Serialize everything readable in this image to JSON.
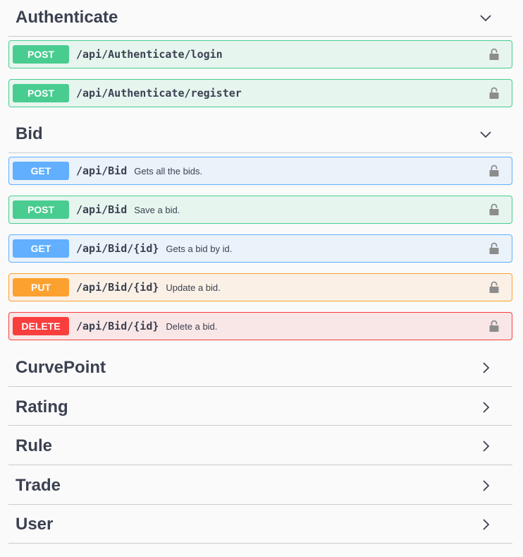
{
  "sections": {
    "authenticate": {
      "title": "Authenticate",
      "operations": [
        {
          "method": "POST",
          "path": "/api/Authenticate/login",
          "summary": ""
        },
        {
          "method": "POST",
          "path": "/api/Authenticate/register",
          "summary": ""
        }
      ]
    },
    "bid": {
      "title": "Bid",
      "operations": [
        {
          "method": "GET",
          "path": "/api/Bid",
          "summary": "Gets all the bids."
        },
        {
          "method": "POST",
          "path": "/api/Bid",
          "summary": "Save a bid."
        },
        {
          "method": "GET",
          "path": "/api/Bid/{id}",
          "summary": "Gets a bid by id."
        },
        {
          "method": "PUT",
          "path": "/api/Bid/{id}",
          "summary": "Update a bid."
        },
        {
          "method": "DELETE",
          "path": "/api/Bid/{id}",
          "summary": "Delete a bid."
        }
      ]
    },
    "collapsed": [
      {
        "title": "CurvePoint"
      },
      {
        "title": "Rating"
      },
      {
        "title": "Rule"
      },
      {
        "title": "Trade"
      },
      {
        "title": "User"
      }
    ]
  },
  "icons": {
    "expanded": "chevron-down-icon",
    "collapsed": "chevron-right-icon",
    "lock": "lock-icon"
  },
  "colors": {
    "post": "#49cc90",
    "get": "#61affe",
    "put": "#fca130",
    "delete": "#f93e3e",
    "text": "#3b4151",
    "lock": "#8c8c8c"
  }
}
